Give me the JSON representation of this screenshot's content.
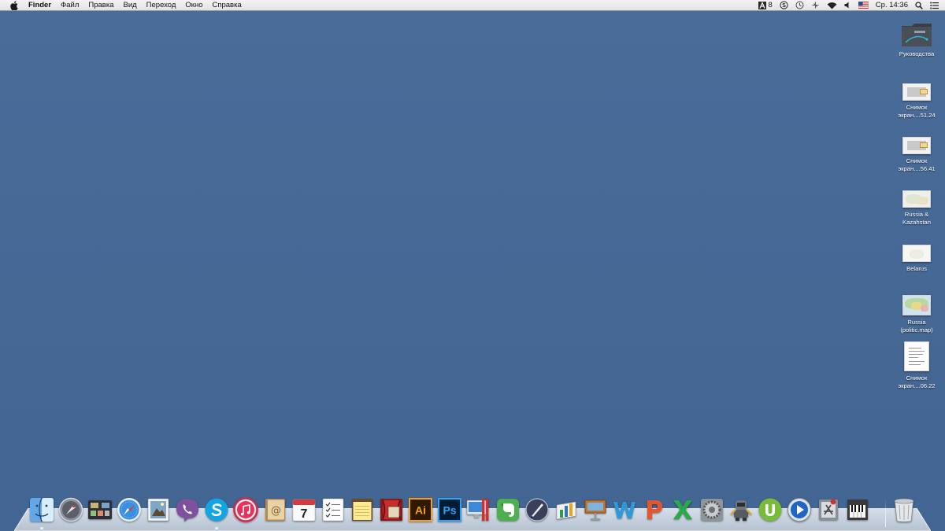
{
  "menubar": {
    "app_name": "Finder",
    "menus": [
      "Файл",
      "Правка",
      "Вид",
      "Переход",
      "Окно",
      "Справка"
    ],
    "status": {
      "adobe_badge": "8",
      "datetime": "Ср. 14:36"
    },
    "icons": [
      "apple-logo-icon",
      "adobe-icon",
      "skype-status-icon",
      "time-machine-icon",
      "bluetooth-icon",
      "wifi-icon",
      "volume-icon",
      "us-flag-icon",
      "spotlight-icon",
      "notification-center-icon"
    ]
  },
  "desktop": {
    "icons": [
      {
        "label": "Руководства",
        "type": "folder"
      },
      {
        "label": "Снимок\nэкран....51.24",
        "type": "screenshot"
      },
      {
        "label": "Снимок\nэкран....56.41",
        "type": "screenshot"
      },
      {
        "label": "Russia &\nKazahstan",
        "type": "map"
      },
      {
        "label": "Belarus",
        "type": "map"
      },
      {
        "label": "Russia\n(politic.map)",
        "type": "map"
      },
      {
        "label": "Снимок\nэкран....06.22",
        "type": "document"
      }
    ]
  },
  "dock": {
    "apps": [
      {
        "name": "finder-icon",
        "running": true
      },
      {
        "name": "launchpad-icon",
        "running": false
      },
      {
        "name": "mission-control-icon",
        "running": false
      },
      {
        "name": "safari-icon",
        "running": false
      },
      {
        "name": "preview-icon",
        "running": false
      },
      {
        "name": "viber-icon",
        "running": false
      },
      {
        "name": "skype-icon",
        "running": true
      },
      {
        "name": "itunes-icon",
        "running": false
      },
      {
        "name": "contacts-icon",
        "running": false
      },
      {
        "name": "calendar-icon",
        "running": false
      },
      {
        "name": "reminders-icon",
        "running": false
      },
      {
        "name": "notes-icon",
        "running": false
      },
      {
        "name": "photo-booth-icon",
        "running": false
      },
      {
        "name": "illustrator-icon",
        "running": false
      },
      {
        "name": "photoshop-icon",
        "running": false
      },
      {
        "name": "parallels-icon",
        "running": false
      },
      {
        "name": "evernote-icon",
        "running": false
      },
      {
        "name": "quill-icon",
        "running": false
      },
      {
        "name": "numbers-icon",
        "running": false
      },
      {
        "name": "keynote-icon",
        "running": false
      },
      {
        "name": "word-icon",
        "running": false
      },
      {
        "name": "powerpoint-icon",
        "running": false
      },
      {
        "name": "excel-icon",
        "running": false
      },
      {
        "name": "system-preferences-icon",
        "running": false
      },
      {
        "name": "automator-icon",
        "running": false
      },
      {
        "name": "utorrent-icon",
        "running": false
      },
      {
        "name": "quicktime-icon",
        "running": false
      },
      {
        "name": "app-store-icon",
        "running": false
      },
      {
        "name": "garageband-icon",
        "running": false
      },
      {
        "name": "trash-icon",
        "running": false
      }
    ],
    "calendar_day": "7",
    "illustrator_label": "Ai",
    "photoshop_label": "Ps"
  },
  "colors": {
    "desktop": "#466a98",
    "menubar": "#e9e9e9"
  }
}
